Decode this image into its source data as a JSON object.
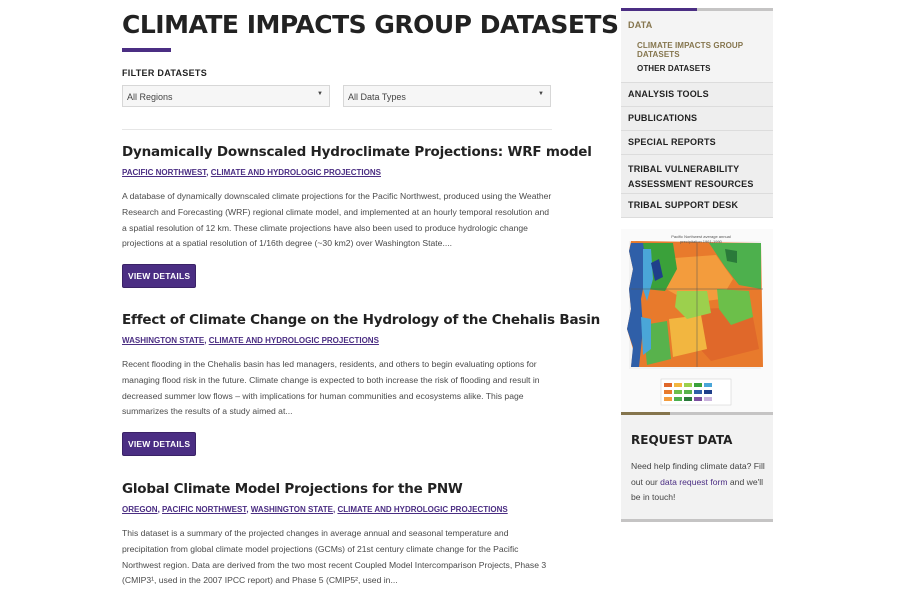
{
  "page": {
    "title": "CLIMATE IMPACTS GROUP DATASETS",
    "filter_label": "FILTER DATASETS",
    "filters": {
      "region_selected": "All Regions",
      "type_selected": "All Data Types"
    },
    "view_button_label": "VIEW DETAILS"
  },
  "datasets": [
    {
      "title": "Dynamically Downscaled Hydroclimate Projections: WRF model",
      "tags": [
        "PACIFIC NORTHWEST",
        "CLIMATE AND HYDROLOGIC PROJECTIONS"
      ],
      "description": "A database of dynamically downscaled climate projections for the Pacific Northwest, produced using the Weather Research and Forecasting (WRF) regional climate model, and implemented at an hourly temporal resolution and a spatial resolution of 12 km. These climate projections have also been used to produce hydrologic change projections at a spatial resolution of 1/16th degree (~30 km2) over Washington State...."
    },
    {
      "title": "Effect of Climate Change on the Hydrology of the Chehalis Basin",
      "tags": [
        "WASHINGTON STATE",
        "CLIMATE AND HYDROLOGIC PROJECTIONS"
      ],
      "description": "Recent flooding in the Chehalis basin has led managers, residents, and others to begin evaluating options for managing flood risk in the future. Climate change is expected to both increase the risk of flooding and result in decreased summer low flows – with implications for human communities and ecosystems alike. This page summarizes the results of a study aimed at..."
    },
    {
      "title": "Global Climate Model Projections for the PNW",
      "tags": [
        "OREGON",
        "PACIFIC NORTHWEST",
        "WASHINGTON STATE",
        "CLIMATE AND HYDROLOGIC PROJECTIONS"
      ],
      "description": "This dataset is a summary of the projected changes in average annual and seasonal temperature and precipitation from global climate model projections (GCMs) of 21st century climate change for the Pacific Northwest region. Data are derived from the two most recent Coupled Model Intercomparison Projects, Phase 3 (CMIP3¹, used in the 2007 IPCC report) and Phase 5 (CMIP5², used in..."
    }
  ],
  "sidebar": {
    "data": "DATA",
    "sub_active": "CLIMATE IMPACTS GROUP DATASETS",
    "sub_other": "OTHER DATASETS",
    "items": [
      "ANALYSIS TOOLS",
      "PUBLICATIONS",
      "SPECIAL REPORTS",
      "TRIBAL VULNERABILITY ASSESSMENT RESOURCES",
      "TRIBAL SUPPORT DESK"
    ],
    "map": {
      "title": "Pacific Northwest average annual precipitation 1961-1990"
    },
    "request": {
      "title": "REQUEST DATA",
      "text_before": "Need help finding climate data? Fill out our ",
      "link": "data request form",
      "text_after": " and we'll be in touch!"
    }
  },
  "colors": {
    "uw_purple": "#4b2e83",
    "uw_gold": "#85754d"
  }
}
